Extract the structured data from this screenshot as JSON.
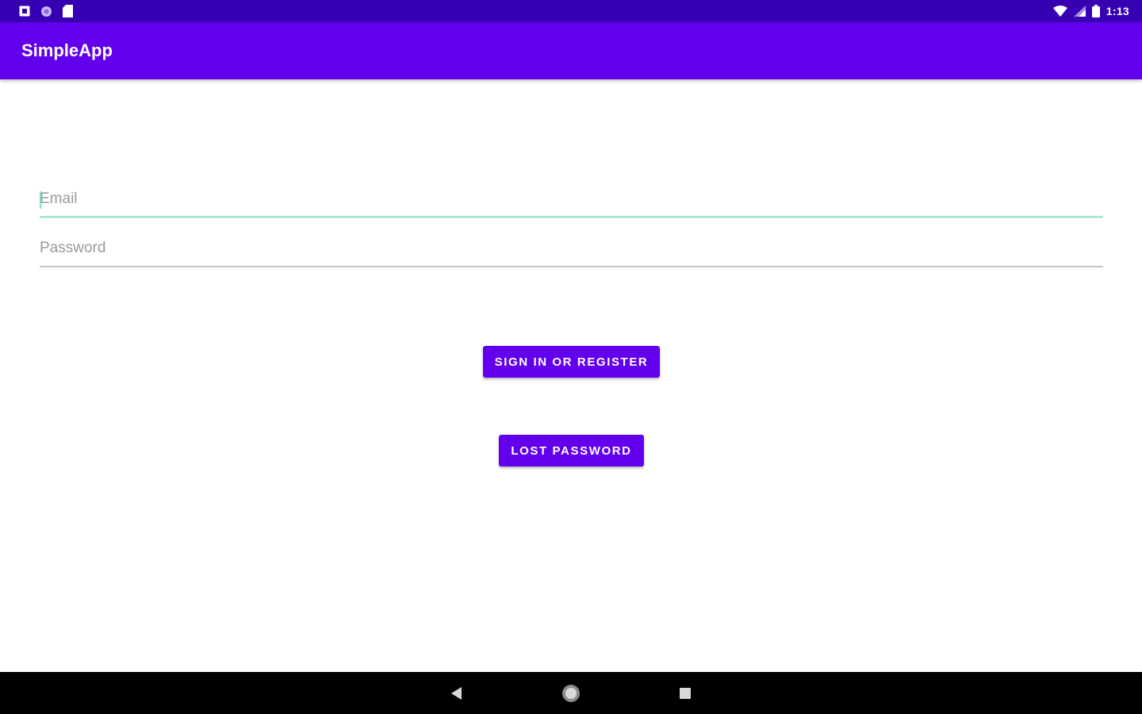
{
  "status_bar": {
    "time": "1:13",
    "left_icons": [
      "notification-icon",
      "sync-icon",
      "sd-card-icon"
    ],
    "right_icons": [
      "wifi-icon",
      "signal-icon",
      "battery-icon"
    ]
  },
  "app_bar": {
    "title": "SimpleApp"
  },
  "form": {
    "email": {
      "placeholder": "Email",
      "value": ""
    },
    "password": {
      "placeholder": "Password",
      "value": ""
    }
  },
  "buttons": {
    "sign_in_label": "SIGN IN OR REGISTER",
    "lost_password_label": "LOST PASSWORD"
  },
  "nav_bar": {
    "icons": [
      "back-icon",
      "home-icon",
      "recents-icon"
    ]
  },
  "colors": {
    "status_bar": "#3700b3",
    "primary": "#6200ee",
    "focus_accent": "#a8e6d8"
  }
}
